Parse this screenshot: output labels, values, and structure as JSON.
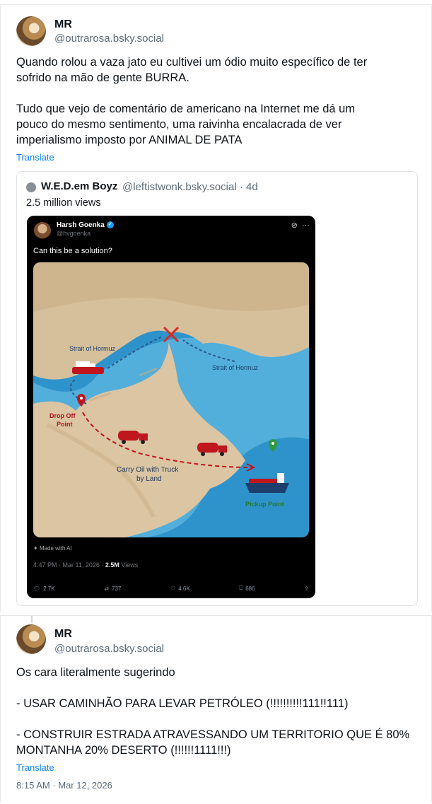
{
  "post1": {
    "author_name": "MR",
    "author_handle": "@outrarosa.bsky.social",
    "text": "Quando rolou a vaza jato eu cultivei um ódio muito específico de ter\nsofrido na mão de gente BURRA.\n\nTudo que vejo de comentário de americano na Internet me dá um\npouco do mesmo sentimento, uma raivinha encalacrada de ver\nimperialismo imposto por ANIMAL DE PATA",
    "translate": "Translate",
    "quote": {
      "author_name": "W.E.D.em Boyz",
      "author_handle": "@leftistwonk.bsky.social · 4d",
      "views": "2.5 million views",
      "screenshot": {
        "name": "Harsh Goenka",
        "handle": "@hvgoenka",
        "question": "Can this be a solution?",
        "map_labels": {
          "strait_left": "Strait of Hormuz",
          "strait_right": "Strait of Hormuz",
          "drop_off_1": "Drop Off",
          "drop_off_2": "Point",
          "carry_1": "Carry Oil with Truck",
          "carry_2": "by Land",
          "pickup": "Pickup Point"
        },
        "made_with_ai": "Made with AI",
        "meta_time": "4:47 PM · Mar 11, 2026 · ",
        "meta_views_count": "2.5M",
        "meta_views_label": " Views",
        "replies": "2.7K",
        "reposts": "737",
        "likes": "4.6K",
        "bookmarks": "686"
      }
    }
  },
  "post2": {
    "author_name": "MR",
    "author_handle": "@outrarosa.bsky.social",
    "text": "Os cara literalmente sugerindo\n\n- USAR CAMINHÃO PARA LEVAR PETRÓLEO (!!!!!!!!!!111!!111)\n\n- CONSTRUIR ESTRADA ATRAVESSANDO UM TERRITORIO QUE É 80%\nMONTANHA 20% DESERTO (!!!!!!1111!!!)",
    "translate": "Translate",
    "timestamp": "8:15 AM · Mar 12, 2026"
  },
  "colors": {
    "link": "#1083fe",
    "muted": "#5b6a78",
    "sea": "#2a8fc7",
    "route": "#c0161e"
  }
}
